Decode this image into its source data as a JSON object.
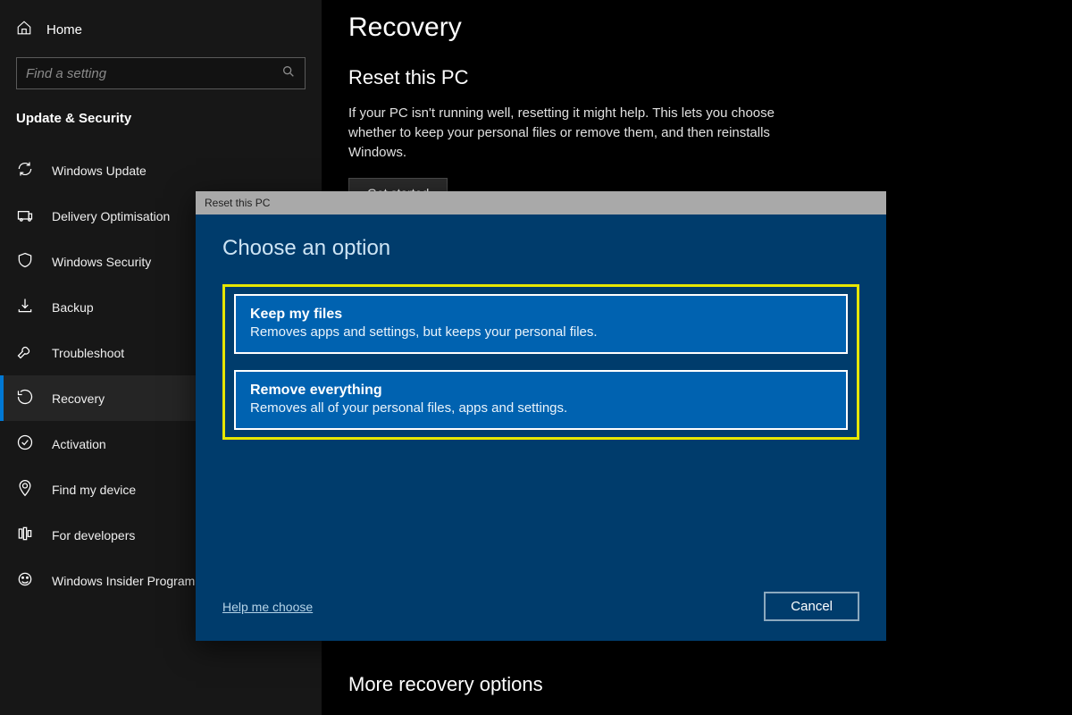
{
  "sidebar": {
    "home_label": "Home",
    "search_placeholder": "Find a setting",
    "category": "Update & Security",
    "items": [
      {
        "label": "Windows Update"
      },
      {
        "label": "Delivery Optimisation"
      },
      {
        "label": "Windows Security"
      },
      {
        "label": "Backup"
      },
      {
        "label": "Troubleshoot"
      },
      {
        "label": "Recovery"
      },
      {
        "label": "Activation"
      },
      {
        "label": "Find my device"
      },
      {
        "label": "For developers"
      },
      {
        "label": "Windows Insider Programme"
      }
    ]
  },
  "main": {
    "page_title": "Recovery",
    "reset": {
      "heading": "Reset this PC",
      "description": "If your PC isn't running well, resetting it might help. This lets you choose whether to keep your personal files or remove them, and then reinstalls Windows.",
      "button": "Get started"
    },
    "more_heading": "More recovery options"
  },
  "dialog": {
    "titlebar": "Reset this PC",
    "heading": "Choose an option",
    "options": [
      {
        "title": "Keep my files",
        "desc": "Removes apps and settings, but keeps your personal files."
      },
      {
        "title": "Remove everything",
        "desc": "Removes all of your personal files, apps and settings."
      }
    ],
    "help_link": "Help me choose",
    "cancel": "Cancel"
  }
}
